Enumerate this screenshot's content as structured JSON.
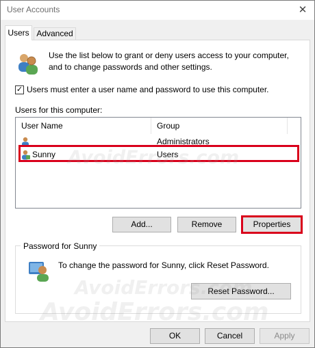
{
  "window": {
    "title": "User Accounts",
    "close_glyph": "✕"
  },
  "tabs": [
    {
      "label": "Users",
      "active": true
    },
    {
      "label": "Advanced",
      "active": false
    }
  ],
  "intro": {
    "text": "Use the list below to grant or deny users access to your computer, and to change passwords and other settings."
  },
  "checkbox": {
    "checked": true,
    "mark": "✓",
    "label": "Users must enter a user name and password to use this computer."
  },
  "users_list": {
    "caption": "Users for this computer:",
    "columns": [
      "User Name",
      "Group"
    ],
    "rows": [
      {
        "name": "",
        "group": "Administrators",
        "selected": false
      },
      {
        "name": "Sunny",
        "group": "Users",
        "selected": true
      }
    ]
  },
  "buttons": {
    "add": "Add...",
    "remove": "Remove",
    "properties": "Properties"
  },
  "password_group": {
    "title": "Password for Sunny",
    "text": "To change the password for Sunny, click Reset Password.",
    "reset_button": "Reset Password..."
  },
  "footer": {
    "ok": "OK",
    "cancel": "Cancel",
    "apply": "Apply",
    "apply_enabled": false
  },
  "watermark": {
    "text": "AvoidErrors.com"
  },
  "colors": {
    "highlight": "#d9001b",
    "window_bg": "#f0f0f0",
    "panel_bg": "#ffffff"
  },
  "icons": {
    "users": "users-group-icon",
    "user": "user-icon",
    "password": "user-password-icon",
    "close": "close-icon"
  }
}
